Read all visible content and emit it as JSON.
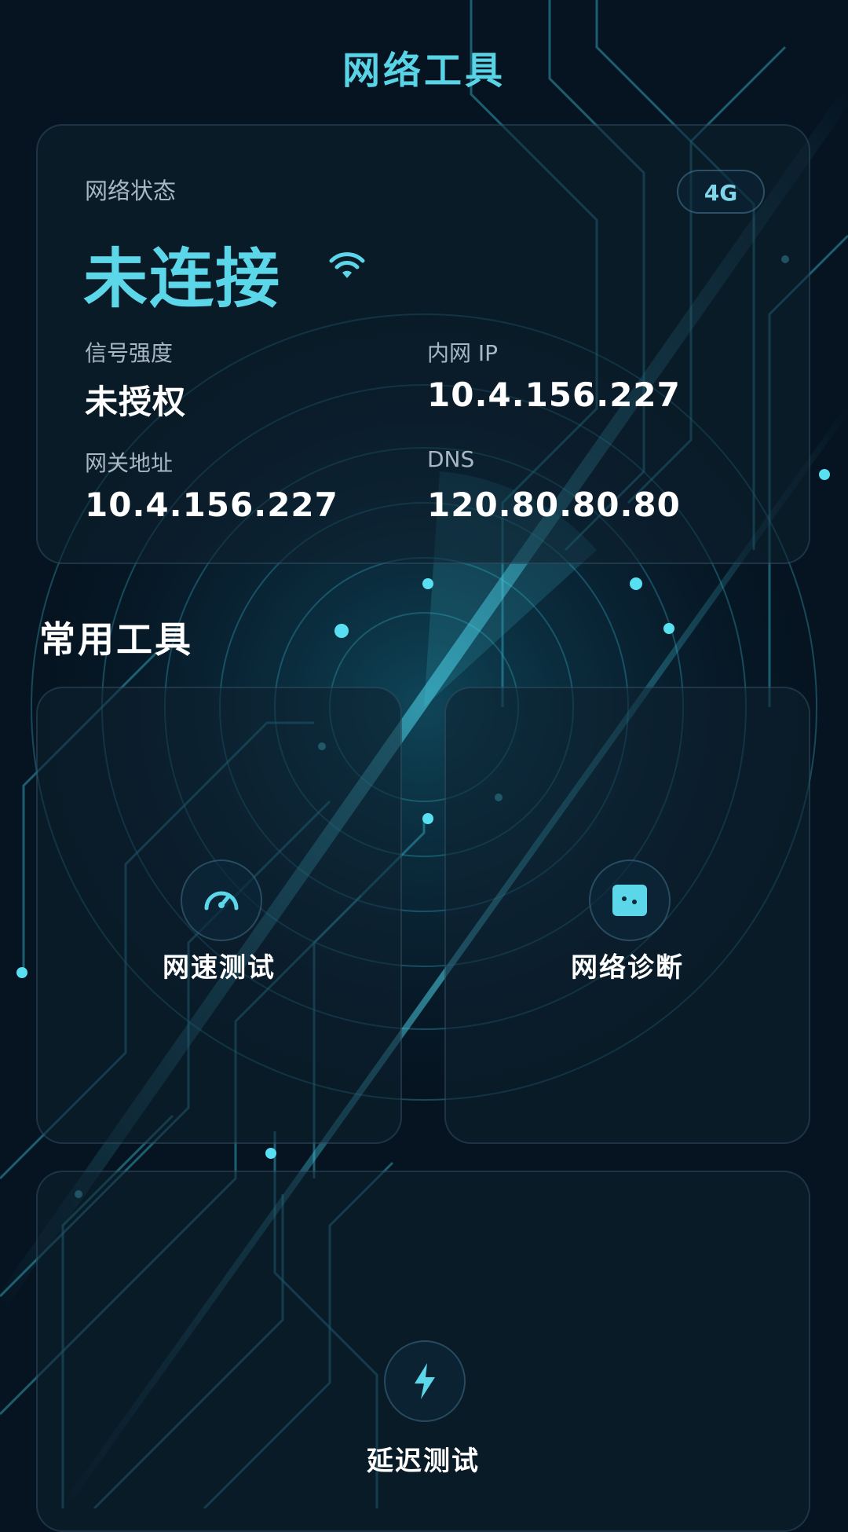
{
  "app": {
    "title": "网络工具"
  },
  "status_card": {
    "label": "网络状态",
    "value": "未连接",
    "network_type": "4G",
    "status_icon": "wifi-icon",
    "fields": [
      {
        "label": "信号强度",
        "value": "未授权"
      },
      {
        "label": "内网 IP",
        "value": "10.4.156.227"
      },
      {
        "label": "网关地址",
        "value": "10.4.156.227"
      },
      {
        "label": "DNS",
        "value": "120.80.80.80"
      }
    ]
  },
  "tools_section": {
    "title": "常用工具",
    "items": [
      {
        "label": "网速测试",
        "icon": "speedometer-icon"
      },
      {
        "label": "网络诊断",
        "icon": "diagnostic-icon"
      },
      {
        "label": "延迟测试",
        "icon": "lightning-icon"
      }
    ]
  },
  "colors": {
    "accent": "#58d4e6",
    "background": "#061421",
    "text_muted": "#a9b7c2"
  }
}
